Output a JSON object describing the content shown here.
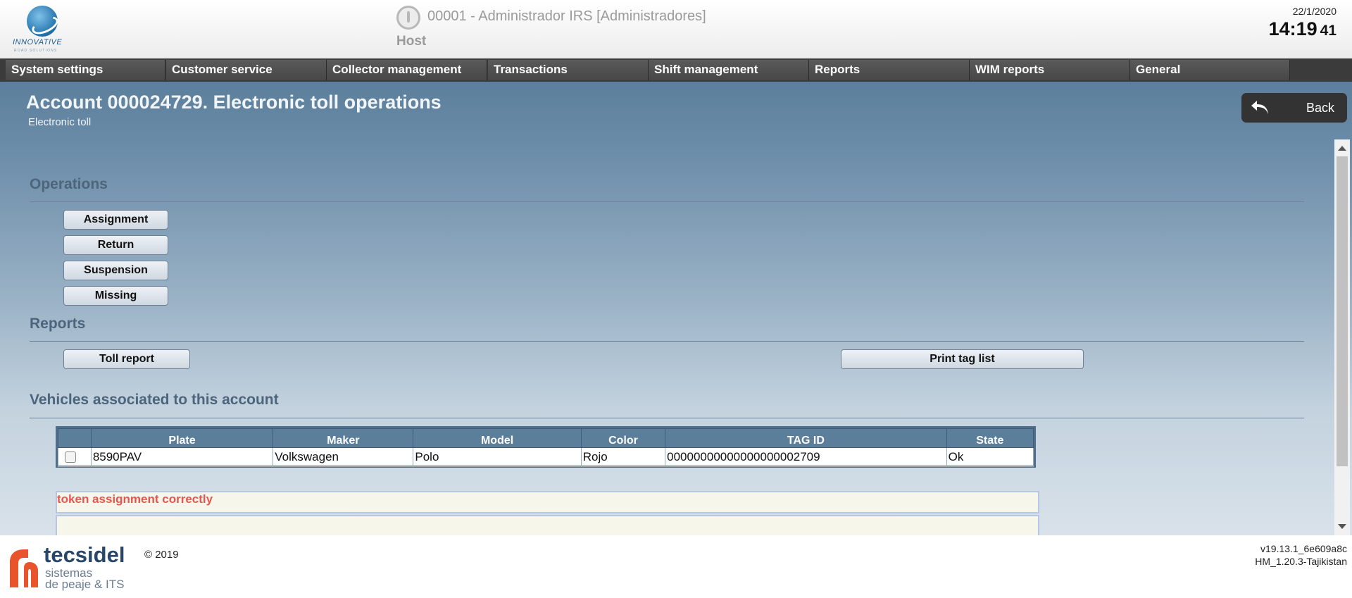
{
  "header": {
    "logo_text": "INNOVATIVE",
    "logo_subtext": "ROAD SOLUTIONS",
    "user": "00001 - Administrador IRS [Administradores]",
    "host": "Host",
    "date": "22/1/2020",
    "time_hm": "14:19",
    "time_s": "41"
  },
  "menu": {
    "items": [
      {
        "label": "System settings"
      },
      {
        "label": "Customer service"
      },
      {
        "label": "Collector management"
      },
      {
        "label": "Transactions"
      },
      {
        "label": "Shift management"
      },
      {
        "label": "Reports"
      },
      {
        "label": "WIM reports"
      },
      {
        "label": "General"
      }
    ]
  },
  "page": {
    "title": "Account 000024729. Electronic toll operations",
    "subtitle": "Electronic toll",
    "back_label": "Back"
  },
  "operations": {
    "title": "Operations",
    "buttons": [
      {
        "label": "Assignment"
      },
      {
        "label": "Return"
      },
      {
        "label": "Suspension"
      },
      {
        "label": "Missing"
      }
    ]
  },
  "reports": {
    "title": "Reports",
    "toll_report_label": "Toll report",
    "print_tag_list_label": "Print tag list"
  },
  "vehicles": {
    "title": "Vehicles associated to this account",
    "columns": [
      "",
      "Plate",
      "Maker",
      "Model",
      "Color",
      "TAG ID",
      "State"
    ],
    "rows": [
      {
        "plate": "8590PAV",
        "maker": "Volkswagen",
        "model": "Polo",
        "color": "Rojo",
        "tag_id": "00000000000000000002709",
        "state": "Ok"
      }
    ]
  },
  "message": "token assignment correctly",
  "footer": {
    "brand_name": "tecsidel",
    "brand_line1": "sistemas",
    "brand_line2": "de peaje & ITS",
    "copyright": "© 2019",
    "version_line1": "v19.13.1_6e609a8c",
    "version_line2": "HM_1.20.3-Tajikistan"
  },
  "colors": {
    "menu_bg": "#474747",
    "table_header": "#5b7e9b",
    "message_text": "#e5554f",
    "brand_orange": "#e8542c",
    "brand_blue": "#27466a"
  }
}
